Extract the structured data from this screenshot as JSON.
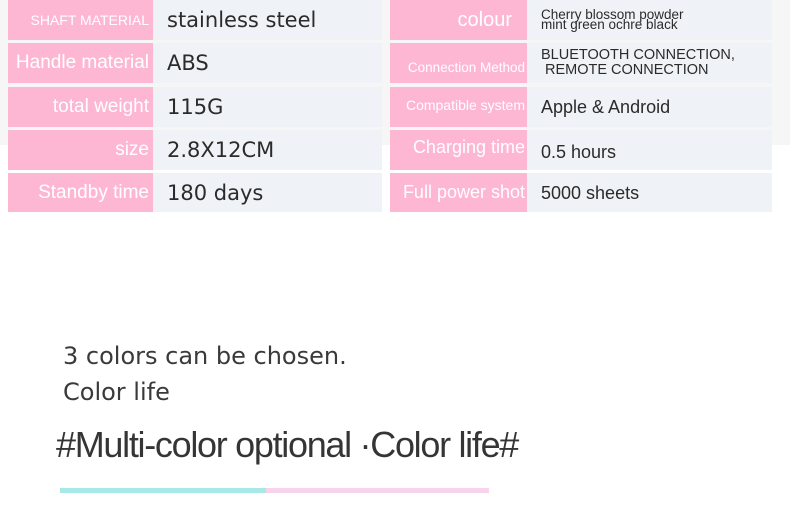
{
  "specs_left": [
    {
      "label": "SHAFT MATERIAL",
      "value": "stainless steel"
    },
    {
      "label": "Handle material",
      "value": "ABS"
    },
    {
      "label": "total weight",
      "value": "115G"
    },
    {
      "label": "size",
      "value": "2.8X12CM"
    },
    {
      "label": "Standby time",
      "value": "180 days"
    }
  ],
  "specs_right": [
    {
      "label": "colour",
      "value_lines": [
        "Cherry blossom powder",
        "mint green ochre black"
      ]
    },
    {
      "label": "Connection Method",
      "value_lines": [
        "BLUETOOTH CONNECTION,",
        "REMOTE CONNECTION"
      ]
    },
    {
      "label": "Compatible system",
      "value": "Apple & Android"
    },
    {
      "label": "Charging time",
      "value": "0.5 hours"
    },
    {
      "label": "Full power shot",
      "value": "5000 sheets"
    }
  ],
  "tagline": {
    "line1": "3 colors can be chosen.",
    "line2": "Color life"
  },
  "headline": "#Multi-color optional ·Color life#",
  "colors": {
    "label_bg": "#feb7d3",
    "value_bg": "#eff2f6",
    "accent_mint": "#a6e9e6",
    "accent_pink": "#f8d3ec"
  }
}
